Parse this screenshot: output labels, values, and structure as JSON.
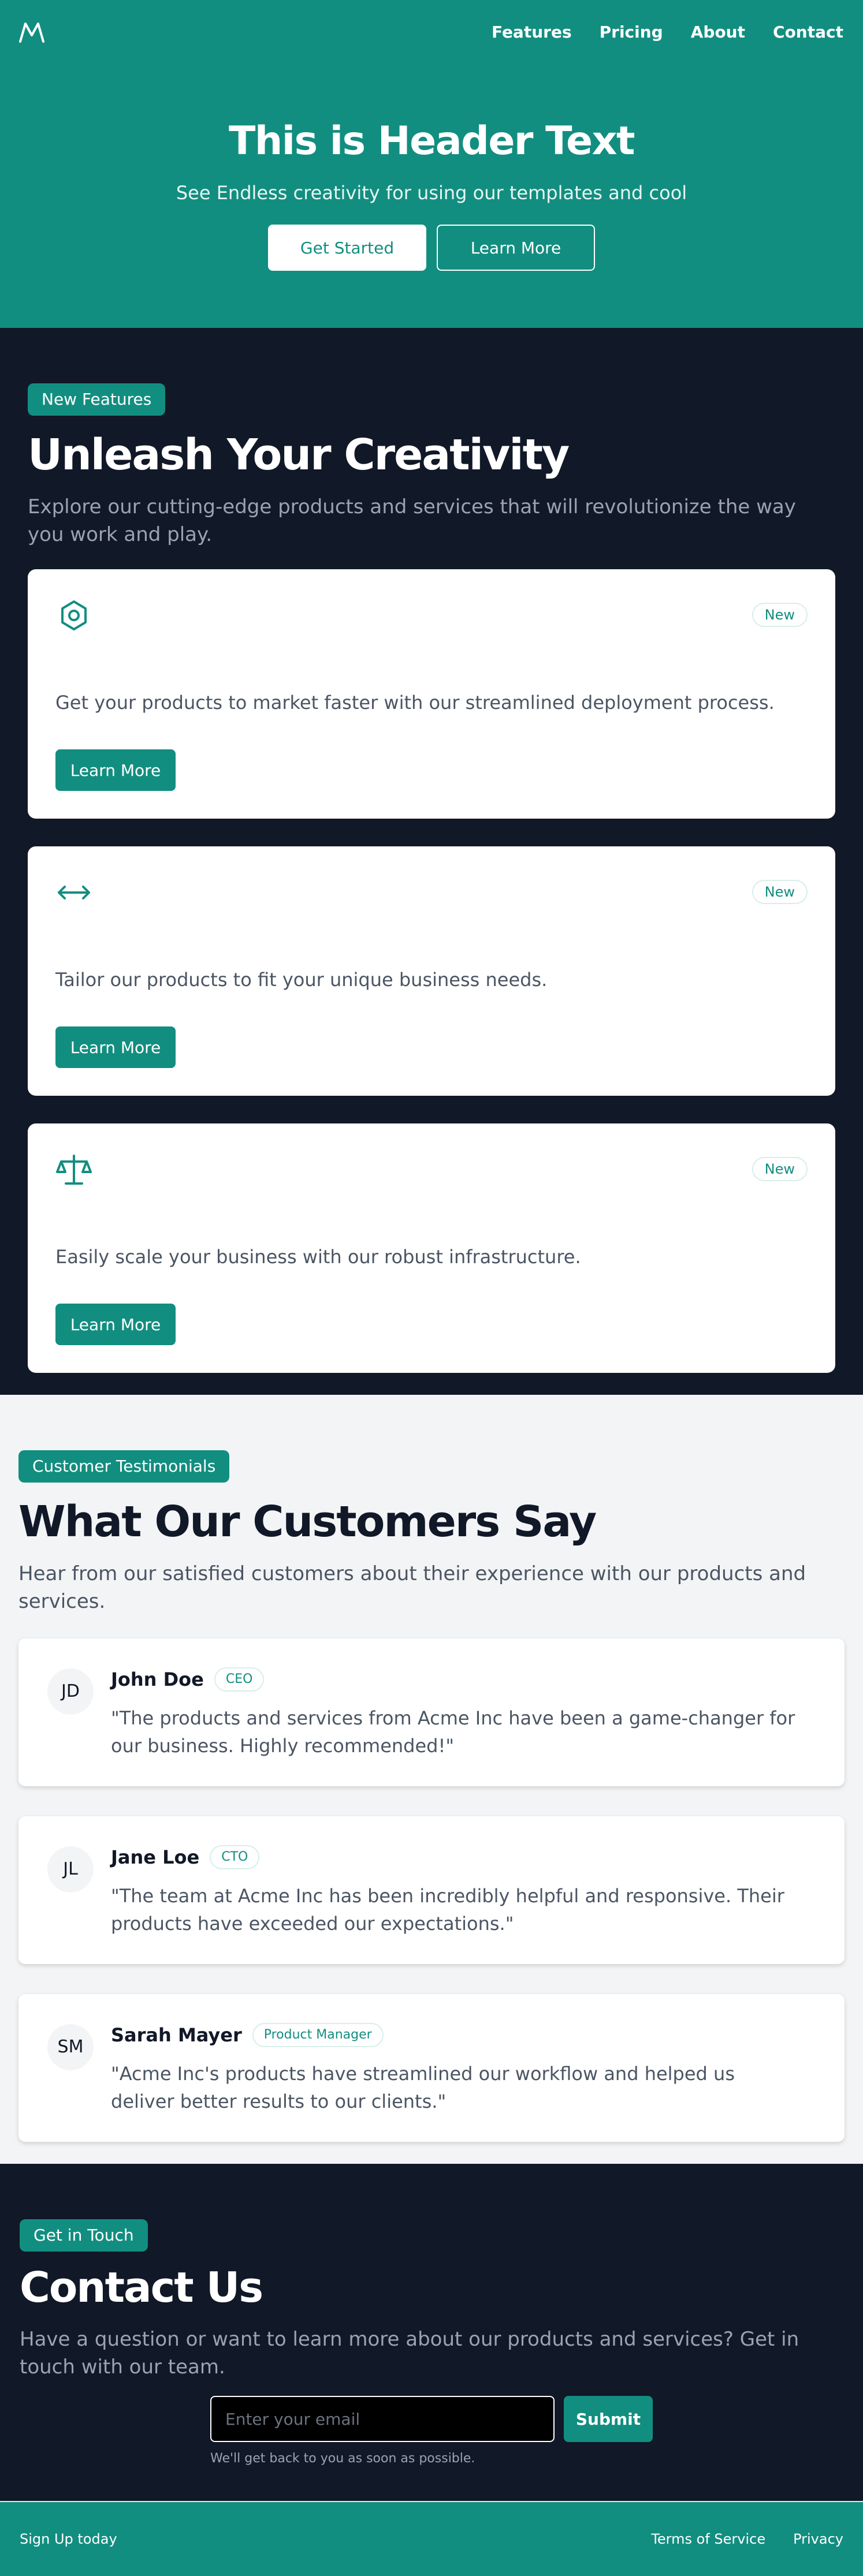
{
  "nav": {
    "links": [
      "Features",
      "Pricing",
      "About",
      "Contact"
    ]
  },
  "hero": {
    "title": "This is Header Text",
    "subtitle": "See Endless creativity for using our templates and cool",
    "primary_button": "Get Started",
    "secondary_button": "Learn More"
  },
  "features": {
    "badge": "New Features",
    "title": "Unleash Your Creativity",
    "description": "Explore our cutting-edge products and services that will revolutionize the way you work and play.",
    "cards": [
      {
        "icon": "hexagon-icon",
        "badge": "New",
        "text": "Get your products to market faster with our streamlined deployment process.",
        "button": "Learn More"
      },
      {
        "icon": "arrows-horizontal-icon",
        "badge": "New",
        "text": "Tailor our products to fit your unique business needs.",
        "button": "Learn More"
      },
      {
        "icon": "scale-icon",
        "badge": "New",
        "text": "Easily scale your business with our robust infrastructure.",
        "button": "Learn More"
      }
    ]
  },
  "testimonials": {
    "badge": "Customer Testimonials",
    "title": "What Our Customers Say",
    "description": "Hear from our satisfied customers about their experience with our products and services.",
    "items": [
      {
        "initials": "JD",
        "name": "John Doe",
        "role": "CEO",
        "quote": "\"The products and services from Acme Inc have been a game-changer for our business. Highly recommended!\""
      },
      {
        "initials": "JL",
        "name": "Jane Loe",
        "role": "CTO",
        "quote": "\"The team at Acme Inc has been incredibly helpful and responsive. Their products have exceeded our expectations.\""
      },
      {
        "initials": "SM",
        "name": "Sarah Mayer",
        "role": "Product Manager",
        "quote": "\"Acme Inc's products have streamlined our workflow and helped us deliver better results to our clients.\""
      }
    ]
  },
  "contact": {
    "badge": "Get in Touch",
    "title": "Contact Us",
    "description": "Have a question or want to learn more about our products and services? Get in touch with our team.",
    "email_placeholder": "Enter your email",
    "submit": "Submit",
    "hint": "We'll get back to you as soon as possible."
  },
  "footer": {
    "left": "Sign Up today",
    "links": [
      "Terms of Service",
      "Privacy"
    ]
  },
  "colors": {
    "accent": "#128e80",
    "dark": "#111827",
    "light": "#f3f4f6"
  }
}
